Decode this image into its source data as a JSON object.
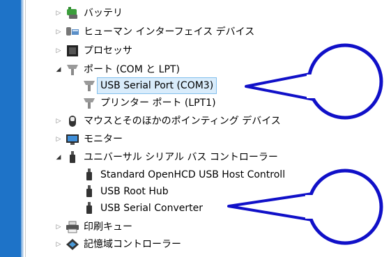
{
  "tree": {
    "items": [
      {
        "label": "バッテリ",
        "icon": "battery-icon",
        "expanded": false
      },
      {
        "label": "ヒューマン インターフェイス デバイス",
        "icon": "hid-icon",
        "expanded": false
      },
      {
        "label": "プロセッサ",
        "icon": "processor-icon",
        "expanded": false
      },
      {
        "label": "ポート (COM と LPT)",
        "icon": "port-icon",
        "expanded": true
      },
      {
        "label": "USB Serial Port (COM3)",
        "icon": "port-icon",
        "selected": true
      },
      {
        "label": "プリンター ポート (LPT1)",
        "icon": "port-icon"
      },
      {
        "label": "マウスとそのほかのポインティング デバイス",
        "icon": "mouse-icon",
        "expanded": false
      },
      {
        "label": "モニター",
        "icon": "monitor-icon",
        "expanded": false
      },
      {
        "label": "ユニバーサル シリアル バス コントローラー",
        "icon": "usb-icon",
        "expanded": true
      },
      {
        "label": "Standard OpenHCD USB Host Controll",
        "icon": "usb-icon"
      },
      {
        "label": "USB Root Hub",
        "icon": "usb-icon"
      },
      {
        "label": "USB Serial Converter",
        "icon": "usb-icon"
      },
      {
        "label": "印刷キュー",
        "icon": "printer-icon",
        "expanded": false
      },
      {
        "label": "記憶域コントローラー",
        "icon": "storage-icon",
        "expanded": false
      }
    ]
  },
  "colors": {
    "accent_strip": "#1e73c8",
    "callout_stroke": "#1010c8",
    "selection_bg": "#d9ecfb"
  }
}
